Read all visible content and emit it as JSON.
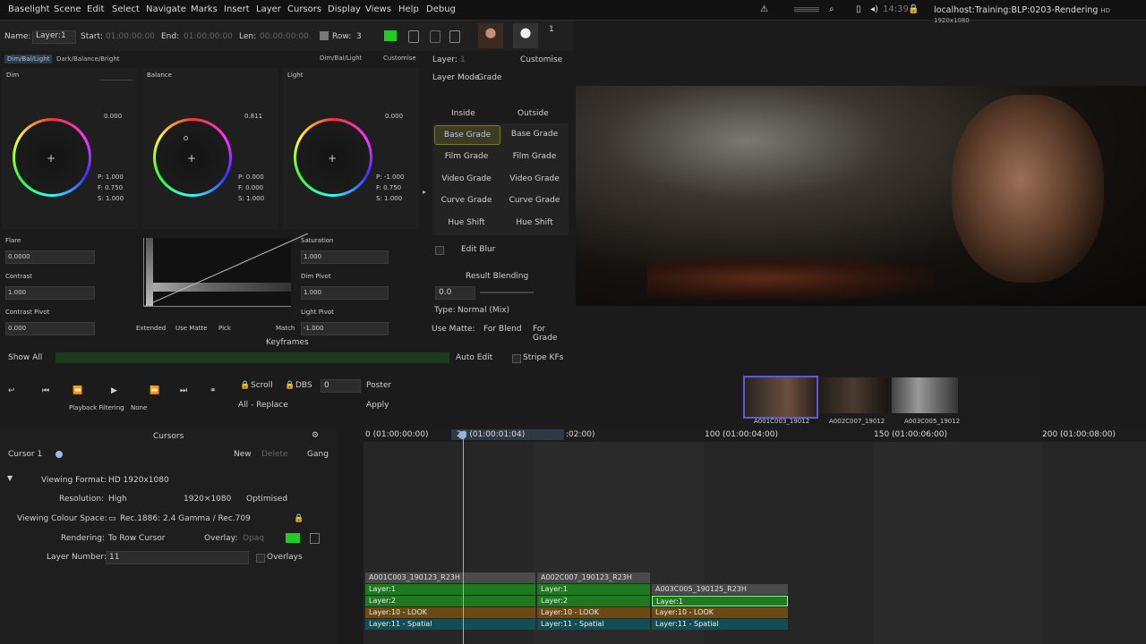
{
  "menu": [
    "Baselight",
    "Scene",
    "Edit",
    "Select",
    "Navigate",
    "Marks",
    "Insert",
    "Layer",
    "Cursors",
    "Display",
    "Views",
    "Help",
    "Debug"
  ],
  "status": {
    "time": "14:39",
    "host": "localhost:Training:BLP:0203-Rendering",
    "format_small": "HD 1920x1080"
  },
  "layerbar": {
    "name_label": "Name:",
    "name_value": "Layer:1",
    "start_label": "Start:",
    "start_value": "01:00:00:00",
    "end_label": "End:",
    "end_value": "01:00:00:00",
    "len_label": "Len:",
    "len_value": "00:00:00:00",
    "row_label": "Row:",
    "row_value": "3",
    "row_num": "1"
  },
  "grade_tabs": {
    "tab1": "Dim/Bal/Light",
    "tab2": "Dark/Balance/Bright",
    "tab3": "Dim/Bal/Light",
    "customise": "Customise"
  },
  "wheels": [
    {
      "title": "Dim",
      "value": "0.000",
      "p": "P: 1.000",
      "f": "F: 0.750",
      "s": "S: 1.000"
    },
    {
      "title": "Balance",
      "value": "0.811",
      "p": "P: 0.000",
      "f": "F: 0.000",
      "s": "S: 1.000"
    },
    {
      "title": "Light",
      "value": "0.000",
      "p": "P: -1.000",
      "f": "F: 0.750",
      "s": "S: 1.000"
    }
  ],
  "sliders_left": [
    {
      "name": "Flare",
      "value": "0.0000"
    },
    {
      "name": "Contrast",
      "value": "1.000"
    },
    {
      "name": "Contrast Pivot",
      "value": "0.000"
    }
  ],
  "sliders_right": [
    {
      "name": "Saturation",
      "value": "1.000"
    },
    {
      "name": "Dim Pivot",
      "value": "1.000"
    },
    {
      "name": "Light Pivot",
      "value": "-1.000"
    }
  ],
  "histogram": {
    "extended": "Extended",
    "use_matte": "Use Matte",
    "pick": "Pick",
    "match": "Match"
  },
  "keyframes": {
    "title": "Keyframes",
    "show_all": "Show All",
    "auto_edit": "Auto Edit",
    "stripe": "Stripe KFs"
  },
  "layer_panel": {
    "layer_label": "Layer:",
    "layer_value": "1",
    "customise": "Customise",
    "mode_label": "Layer Mode",
    "mode_value": "Grade",
    "inside": "Inside",
    "outside": "Outside",
    "grades": [
      "Base Grade",
      "Film Grade",
      "Video Grade",
      "Curve Grade",
      "Hue Shift"
    ],
    "edit_blur": "Edit Blur",
    "result_blending": "Result Blending",
    "blend_value": "0.0",
    "type_label": "Type:",
    "type_value": "Normal (Mix)",
    "use_matte": "Use Matte:",
    "for_blend": "For Blend",
    "for_grade": "For Grade"
  },
  "transport": {
    "scroll": "Scroll",
    "dbs": "DBS",
    "dbs_value": "0",
    "poster": "Poster",
    "replace": "All - Replace",
    "apply": "Apply",
    "pb_filter": "Playback Filtering",
    "pb_value": "None"
  },
  "thumbs": [
    "A001C003_19012",
    "A002C007_19012",
    "A003C005_19012"
  ],
  "cursors": {
    "title": "Cursors",
    "cursor": "Cursor 1",
    "new": "New",
    "delete": "Delete",
    "gang": "Gang",
    "viewing_format_label": "Viewing Format:",
    "viewing_format": "HD 1920x1080",
    "resolution_label": "Resolution:",
    "resolution": "High",
    "resolution_size": "1920×1080",
    "optimised": "Optimised",
    "colour_space_label": "Viewing Colour Space:",
    "colour_space": "Rec.1886: 2.4 Gamma / Rec.709",
    "rendering_label": "Rendering:",
    "rendering": "To Row Cursor",
    "overlay_label": "Overlay:",
    "overlay": "Opaq",
    "layer_number_label": "Layer Number:",
    "layer_number": "11",
    "overlays": "Overlays"
  },
  "timeline": {
    "ticks": [
      "0 (01:00:00:00)",
      "29 (01:00:01:04)",
      ":02:00)",
      "100 (01:00:04:00)",
      "150 (01:00:06:00)",
      "200 (01:00:08:00)"
    ],
    "shot1": {
      "name": "A001C003_190123_R23H",
      "layers": [
        "Layer:1",
        "Layer:2",
        "Layer:10 - LOOK",
        "Layer:11 - Spatial"
      ]
    },
    "shot2": {
      "name": "A002C007_190123_R23H",
      "layers": [
        "Layer:1",
        "Layer:2",
        "Layer:10 - LOOK",
        "Layer:11 - Spatial"
      ]
    },
    "shot3": {
      "name": "A003C005_190125_R23H",
      "layers": [
        "Layer:1",
        "Layer:10 - LOOK",
        "Layer:11 - Spatial"
      ]
    }
  },
  "colors": {
    "accent_green": "#22cc22",
    "grade_highlight": "#7a7a2a",
    "teal": "#124e56",
    "brown": "#6b4a14"
  }
}
